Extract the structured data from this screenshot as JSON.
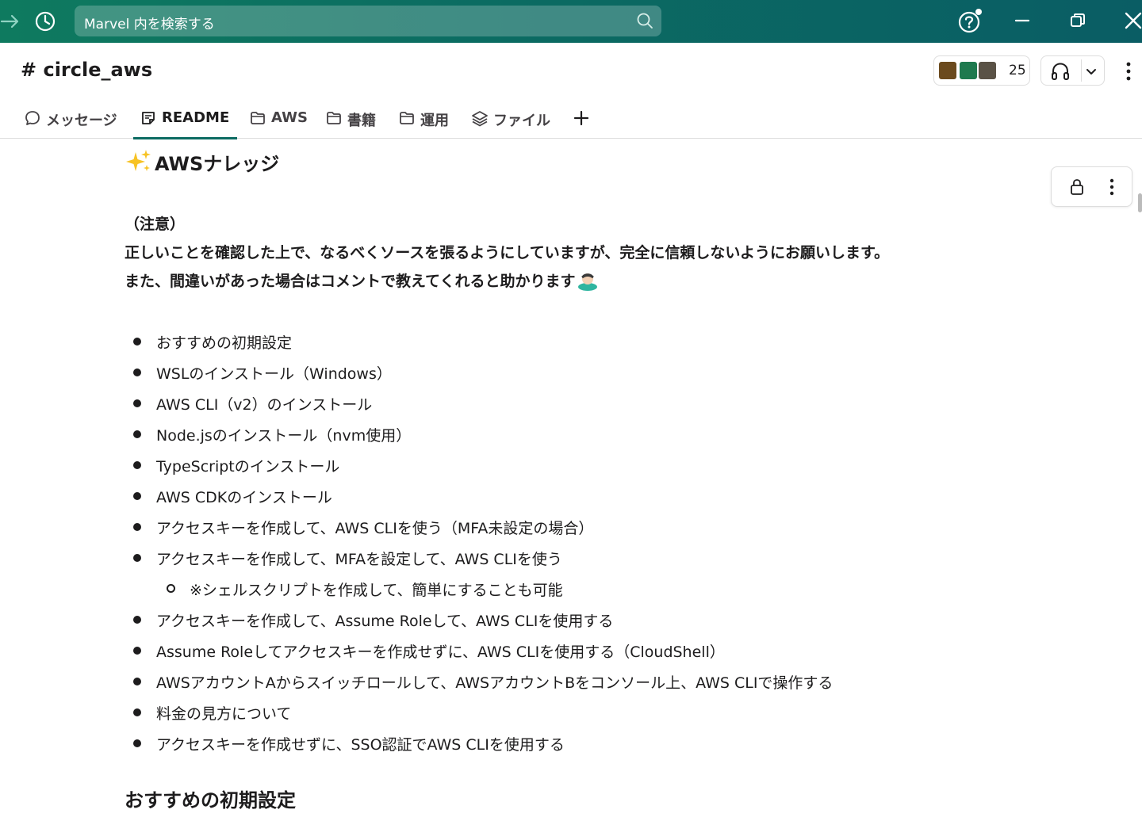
{
  "search": {
    "placeholder": "Marvel 内を検索する"
  },
  "channel": {
    "title": "# circle_aws",
    "member_count": "25"
  },
  "tabs": [
    {
      "label": "メッセージ",
      "icon": "message-icon"
    },
    {
      "label": "README",
      "icon": "canvas-icon"
    },
    {
      "label": "AWS",
      "icon": "folder-icon"
    },
    {
      "label": "書籍",
      "icon": "folder-icon"
    },
    {
      "label": "運用",
      "icon": "folder-icon"
    },
    {
      "label": "ファイル",
      "icon": "layers-icon"
    }
  ],
  "doc": {
    "title": "AWSナレッジ",
    "note_heading": "（注意）",
    "note_line1": "正しいことを確認した上で、なるべくソースを張るようにしていますが、完全に信頼しないようにお願いします。",
    "note_line2": "また、間違いがあった場合はコメントで教えてくれると助かります",
    "items": [
      {
        "text": "おすすめの初期設定",
        "level": 1
      },
      {
        "text": "WSLのインストール（Windows）",
        "level": 1
      },
      {
        "text": "AWS CLI（v2）のインストール",
        "level": 1
      },
      {
        "text": "Node.jsのインストール（nvm使用）",
        "level": 1
      },
      {
        "text": "TypeScriptのインストール",
        "level": 1
      },
      {
        "text": "AWS CDKのインストール",
        "level": 1
      },
      {
        "text": "アクセスキーを作成して、AWS CLIを使う（MFA未設定の場合）",
        "level": 1
      },
      {
        "text": "アクセスキーを作成して、MFAを設定して、AWS CLIを使う",
        "level": 1
      },
      {
        "text": "※シェルスクリプトを作成して、簡単にすることも可能",
        "level": 2
      },
      {
        "text": "アクセスキーを作成して、Assume Roleして、AWS CLIを使用する",
        "level": 1
      },
      {
        "text": "Assume Roleしてアクセスキーを作成せずに、AWS CLIを使用する（CloudShell）",
        "level": 1
      },
      {
        "text": "AWSアカウントAからスイッチロールして、AWSアカウントBをコンソール上、AWS CLIで操作する",
        "level": 1
      },
      {
        "text": "料金の見方について",
        "level": 1
      },
      {
        "text": "アクセスキーを作成せずに、SSO認証でAWS CLIを使用する",
        "level": 1
      }
    ],
    "section_heading": "おすすめの初期設定"
  },
  "colors": {
    "topbar": "#0b6b62",
    "accent": "#0b6b62",
    "text": "#1d1c1d"
  }
}
